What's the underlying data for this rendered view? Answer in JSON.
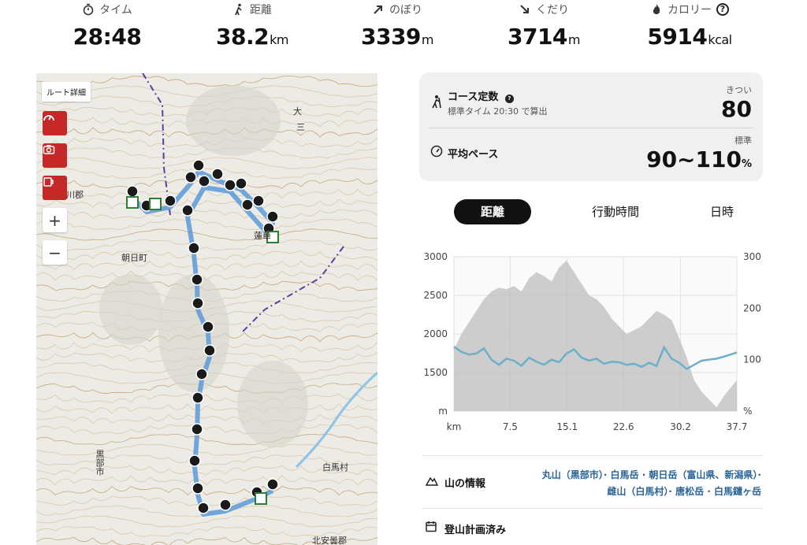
{
  "stats": [
    {
      "icon": "stopwatch-icon",
      "label": "タイム",
      "value": "28:48",
      "unit": ""
    },
    {
      "icon": "walker-icon",
      "label": "距離",
      "value": "38.2",
      "unit": "km"
    },
    {
      "icon": "arrow-up-right-icon",
      "label": "のぼり",
      "value": "3339",
      "unit": "m"
    },
    {
      "icon": "arrow-down-right-icon",
      "label": "くだり",
      "value": "3714",
      "unit": "m"
    },
    {
      "icon": "flame-icon",
      "label": "カロリー",
      "value": "5914",
      "unit": "kcal"
    }
  ],
  "map": {
    "route_detail_label": "ルート詳細",
    "zoom_in": "+",
    "zoom_out": "−",
    "place_labels": [
      "川郡",
      "朝日町",
      "黒部市",
      "白馬村",
      "北安曇郡",
      "蓮華",
      "大",
      "三"
    ]
  },
  "course": {
    "title": "コース定数",
    "subtitle": "標準タイム 20:30 で算出",
    "difficulty_label": "きつい",
    "value": "80",
    "pace_title": "平均ペース",
    "pace_label": "標準",
    "pace_value": "90~110",
    "pace_unit": "%"
  },
  "tabs": [
    "距離",
    "行動時間",
    "日時"
  ],
  "chart_data": {
    "type": "area",
    "x_ticks": [
      "km",
      "7.5",
      "15.1",
      "22.6",
      "30.2",
      "37.7"
    ],
    "y_left_ticks": [
      "3000",
      "2500",
      "2000",
      "1500",
      "m"
    ],
    "y_right_ticks": [
      "300",
      "200",
      "100",
      "%"
    ],
    "ylim_left": [
      1000,
      3000
    ],
    "ylim_right": [
      0,
      300
    ],
    "xlim": [
      0,
      37.7
    ],
    "series": [
      {
        "axis": "left",
        "x": [
          0,
          1,
          2,
          3,
          4,
          5,
          6,
          7,
          8,
          9,
          10,
          11,
          12,
          13,
          14,
          15,
          16,
          17,
          18,
          19,
          20,
          21,
          22,
          23,
          24,
          25,
          26,
          27,
          28,
          29,
          30,
          31,
          32,
          33,
          34,
          35,
          36,
          37.7
        ],
        "values": [
          1800,
          2000,
          2150,
          2300,
          2450,
          2550,
          2600,
          2580,
          2620,
          2550,
          2720,
          2800,
          2750,
          2680,
          2860,
          2950,
          2800,
          2650,
          2500,
          2450,
          2350,
          2200,
          2100,
          2000,
          2050,
          2100,
          2200,
          2300,
          2250,
          2180,
          1950,
          1700,
          1400,
          1250,
          1150,
          1050,
          1200,
          1400
        ]
      },
      {
        "axis": "right",
        "x": [
          0,
          1,
          2,
          3,
          4,
          5,
          6,
          7,
          8,
          9,
          10,
          11,
          12,
          13,
          14,
          15,
          16,
          17,
          18,
          19,
          20,
          21,
          22,
          23,
          24,
          25,
          26,
          27,
          28,
          29,
          30,
          31,
          32,
          33,
          34,
          35,
          36,
          37.7
        ],
        "values": [
          125,
          115,
          110,
          112,
          122,
          100,
          90,
          102,
          98,
          88,
          104,
          96,
          90,
          100,
          95,
          112,
          120,
          104,
          98,
          102,
          92,
          96,
          95,
          90,
          92,
          86,
          94,
          88,
          124,
          102,
          94,
          82,
          90,
          98,
          100,
          102,
          106,
          114
        ]
      }
    ]
  },
  "info": {
    "mountain_title": "山の情報",
    "mountains_line1": "丸山（黒部市）· 白馬岳 · 朝日岳（富山県、新潟県）·",
    "mountains_line2": "雌山（白馬村）· 唐松岳 · 白馬鑓ヶ岳",
    "plan_title": "登山計画済み"
  }
}
